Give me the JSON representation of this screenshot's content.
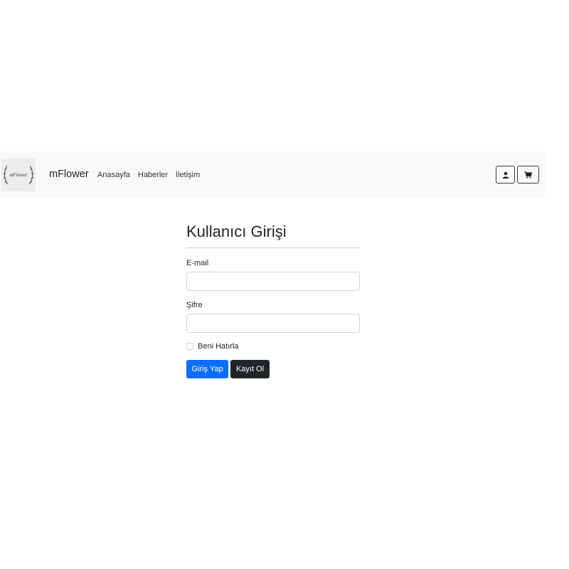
{
  "navbar": {
    "logo_text": "mFlower",
    "brand": "mFlower",
    "links": [
      "Anasayfa",
      "Haberler",
      "İletişim"
    ],
    "user_icon": "user-icon",
    "cart_icon": "cart-icon"
  },
  "form": {
    "title": "Kullanıcı Girişi",
    "email_label": "E-mail",
    "email_value": "",
    "password_label": "Şifre",
    "password_value": "",
    "remember_label": "Beni Hatırla",
    "remember_checked": false,
    "login_button": "Giriş Yap",
    "register_button": "Kayıt Ol"
  },
  "colors": {
    "primary": "#0d6efd",
    "dark": "#212529",
    "navbar_bg": "#f8f9fa"
  }
}
